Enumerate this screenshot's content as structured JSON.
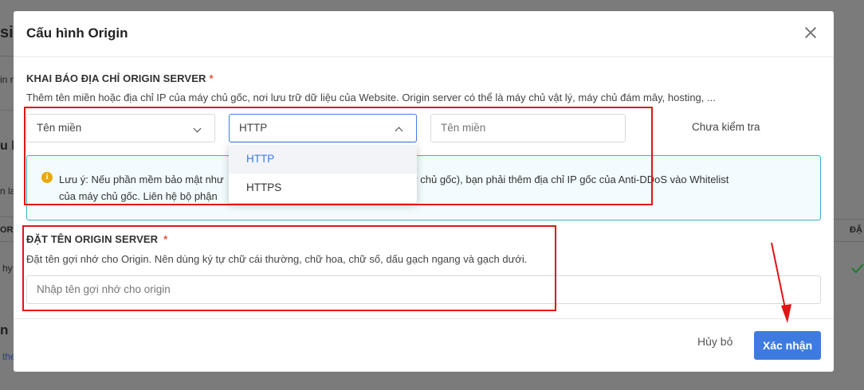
{
  "background": {
    "fragments": [
      "si",
      "in n",
      "u h",
      "n la",
      "OR",
      "hy",
      "n",
      "the",
      "ĐẶ"
    ]
  },
  "modal": {
    "title": "Cấu hình Origin",
    "section1": {
      "label": "KHAI BÁO ĐỊA CHỈ ORIGIN SERVER",
      "required_mark": "*",
      "description": "Thêm tên miền hoặc địa chỉ IP của máy chủ gốc, nơi lưu trữ dữ liệu của Website. Origin server có thể là máy chủ vật lý, máy chủ đám mây, hosting, ...",
      "type_select": {
        "value": "Tên miền"
      },
      "protocol_select": {
        "value": "HTTP",
        "options": [
          "HTTP",
          "HTTPS"
        ],
        "selected": "HTTP"
      },
      "domain_input": {
        "placeholder": "Tên miền"
      },
      "status": "Chưa kiểm tra"
    },
    "info": {
      "icon": "info-icon",
      "line1_start": "Lưu ý: Nếu phần mềm bảo mật như",
      "line1_end": "(máy chủ gốc), bạn phải thêm địa chỉ IP gốc của Anti-DDoS vào Whitelist",
      "line2": "của máy chủ gốc. Liên hệ bộ phận"
    },
    "section2": {
      "label": "ĐẶT TÊN ORIGIN SERVER",
      "required_mark": "*",
      "description": "Đặt tên gợi nhớ cho Origin. Nên dùng ký tự chữ cái thường, chữ hoa, chữ số, dấu gạch ngang và gạch dưới.",
      "name_input": {
        "placeholder": "Nhập tên gợi nhớ cho origin"
      }
    },
    "footer": {
      "cancel_label": "Hủy bỏ",
      "confirm_label": "Xác nhận"
    }
  },
  "colors": {
    "primary": "#3d7be0",
    "annotation": "#e01515",
    "required": "#e8543c",
    "info_border": "#38b2c4"
  }
}
